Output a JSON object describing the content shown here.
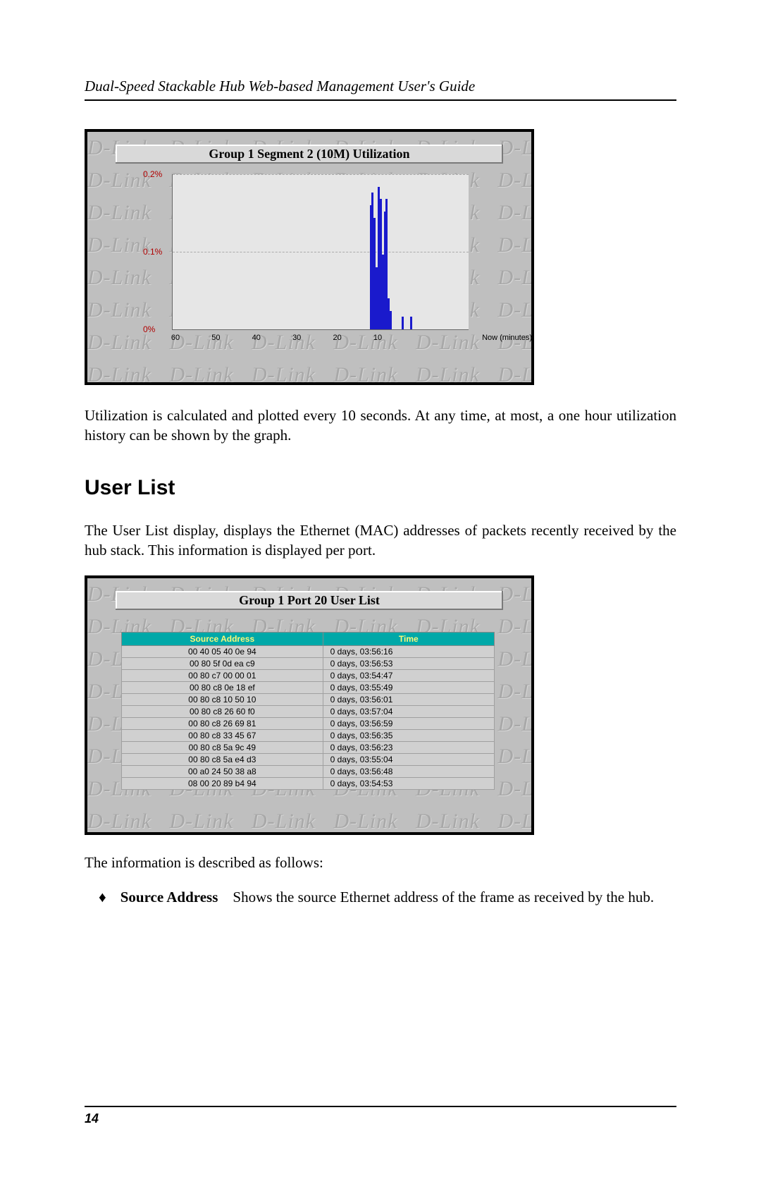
{
  "running_head": "Dual-Speed Stackable Hub Web-based Management User's Guide",
  "page_number": "14",
  "chart_data": {
    "type": "bar",
    "title": "Group 1 Segment 2 (10M) Utilization",
    "xlabel": "Now (minutes)",
    "ylabel": "",
    "yticks": [
      "0%",
      "0.1%",
      "0.2%"
    ],
    "xticks": [
      "60",
      "50",
      "40",
      "30",
      "20",
      "10"
    ],
    "ylim": [
      0,
      0.25
    ],
    "bars": [
      {
        "x_min_ago": 12,
        "h": 0.2
      },
      {
        "x_min_ago": 11.5,
        "h": 0.22
      },
      {
        "x_min_ago": 11,
        "h": 0.18
      },
      {
        "x_min_ago": 10.5,
        "h": 0.1
      },
      {
        "x_min_ago": 10,
        "h": 0.23
      },
      {
        "x_min_ago": 9.5,
        "h": 0.21
      },
      {
        "x_min_ago": 9,
        "h": 0.12
      },
      {
        "x_min_ago": 8.5,
        "h": 0.19
      },
      {
        "x_min_ago": 8,
        "h": 0.21
      },
      {
        "x_min_ago": 7.5,
        "h": 0.05
      },
      {
        "x_min_ago": 7,
        "h": 0.03
      },
      {
        "x_min_ago": 4,
        "h": 0.02
      },
      {
        "x_min_ago": 2,
        "h": 0.02
      }
    ]
  },
  "para1": "Utilization is calculated and plotted every 10 seconds.  At any time, at most, a one hour utilization history can be shown by the graph.",
  "section_heading": "User List",
  "para2": "The User List display, displays the Ethernet (MAC) addresses of packets recently received by the hub stack.  This information is displayed per port.",
  "userlist": {
    "title": "Group 1 Port 20 User List",
    "headers": [
      "Source Address",
      "Time"
    ],
    "rows": [
      [
        "00 40 05 40 0e 94",
        "0 days, 03:56:16"
      ],
      [
        "00 80 5f 0d ea c9",
        "0 days, 03:56:53"
      ],
      [
        "00 80 c7 00 00 01",
        "0 days, 03:54:47"
      ],
      [
        "00 80 c8 0e 18 ef",
        "0 days, 03:55:49"
      ],
      [
        "00 80 c8 10 50 10",
        "0 days, 03:56:01"
      ],
      [
        "00 80 c8 26 60 f0",
        "0 days, 03:57:04"
      ],
      [
        "00 80 c8 26 69 81",
        "0 days, 03:56:59"
      ],
      [
        "00 80 c8 33 45 67",
        "0 days, 03:56:35"
      ],
      [
        "00 80 c8 5a 9c 49",
        "0 days, 03:56:23"
      ],
      [
        "00 80 c8 5a e4 d3",
        "0 days, 03:55:04"
      ],
      [
        "00 a0 24 50 38 a8",
        "0 days, 03:56:48"
      ],
      [
        "08 00 20 89 b4 94",
        "0 days, 03:54:53"
      ]
    ]
  },
  "para3": "The information is described as follows:",
  "bullet": {
    "mark": "♦",
    "label": "Source Address",
    "desc": " Shows the source Ethernet address of the frame as received by the hub."
  },
  "dlink_word": "D-Link"
}
